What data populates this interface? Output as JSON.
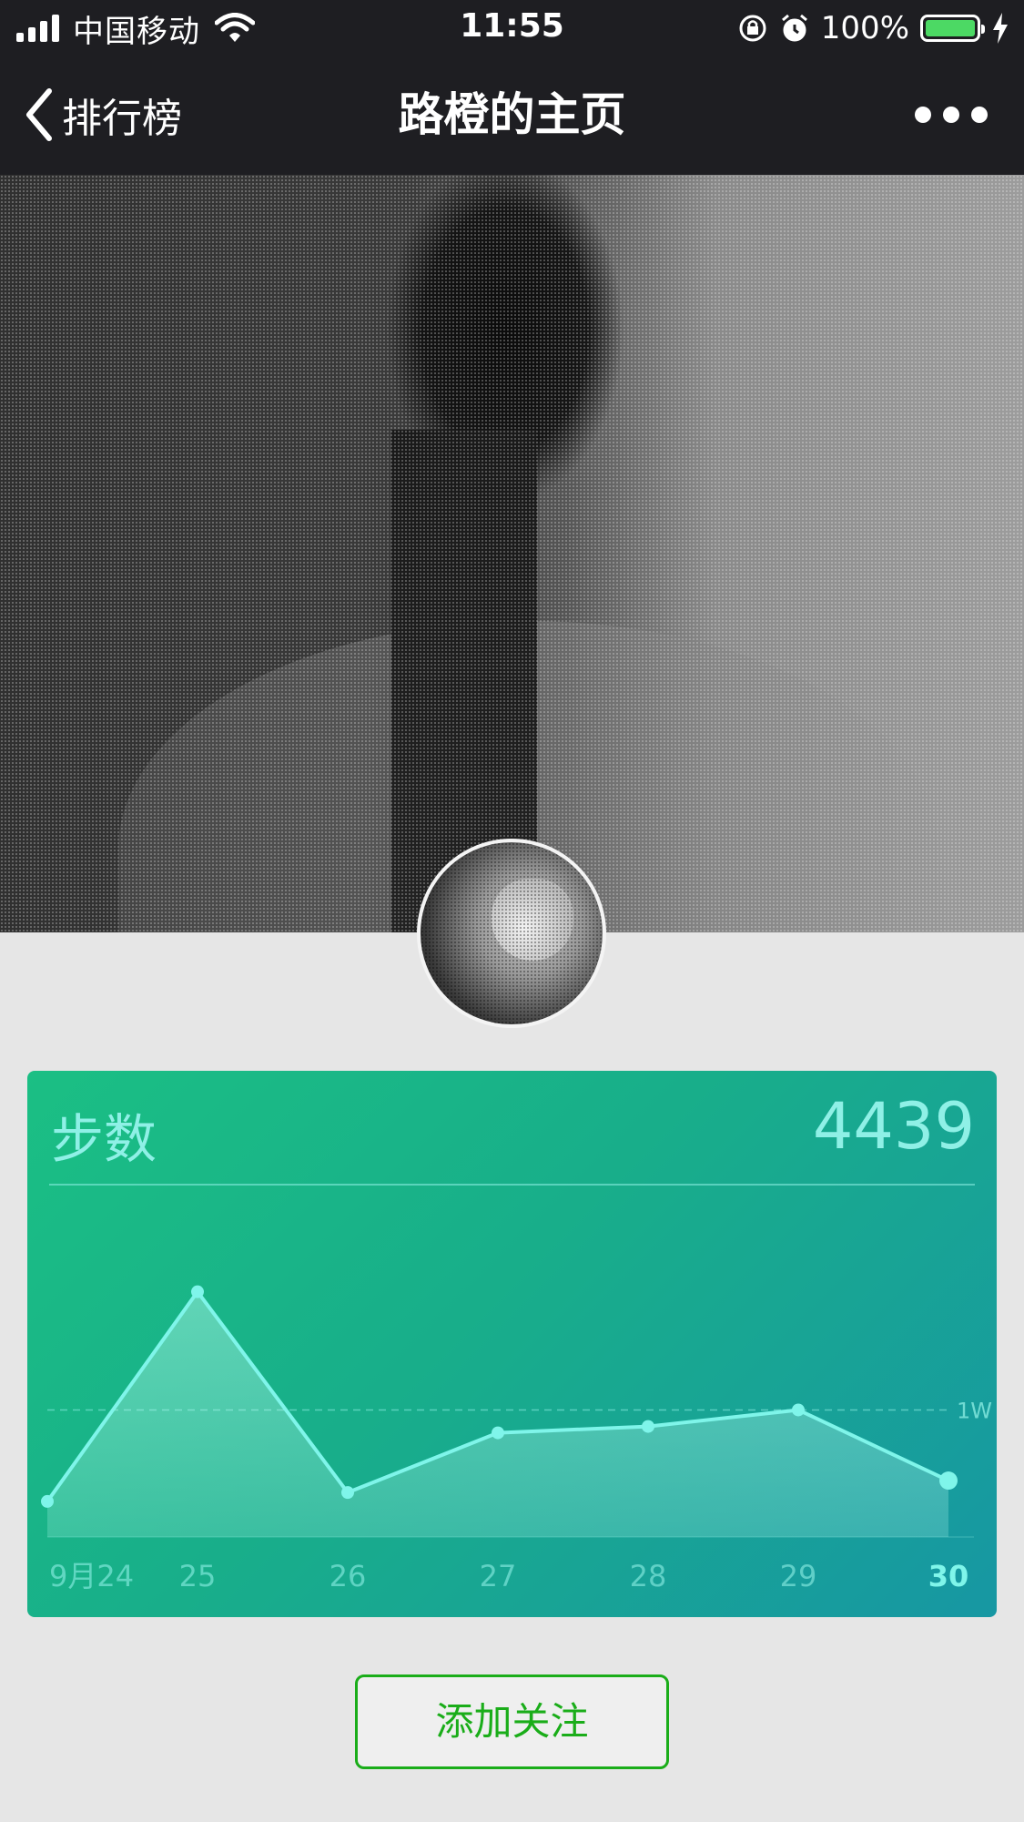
{
  "status_bar": {
    "carrier": "中国移动",
    "time": "11:55",
    "battery_percent": "100%",
    "battery_level": 1.0,
    "battery_color": "#4cd964"
  },
  "nav": {
    "back_label": "排行榜",
    "title": "路橙的主页",
    "more_icon": "more-dots-icon"
  },
  "card": {
    "title": "步数",
    "value": "4439"
  },
  "chart_data": {
    "type": "area",
    "categories": [
      "9月24",
      "25",
      "26",
      "27",
      "28",
      "29",
      "30"
    ],
    "values": [
      2800,
      19300,
      3500,
      8200,
      8700,
      10000,
      4439
    ],
    "highlight_index": 6,
    "reference_line": {
      "value": 10000,
      "label": "1W"
    },
    "ylim": [
      0,
      22000
    ],
    "grid": false,
    "line_color": "#7ff5ea",
    "title": "",
    "xlabel": "",
    "ylabel": ""
  },
  "actions": {
    "follow_label": "添加关注",
    "follow_color": "#1aad19"
  },
  "colors": {
    "nav_background": "#1e1e22",
    "card_gradient_start": "#1bbf84",
    "card_gradient_end": "#1797a3",
    "card_text": "#8ff0e6"
  }
}
